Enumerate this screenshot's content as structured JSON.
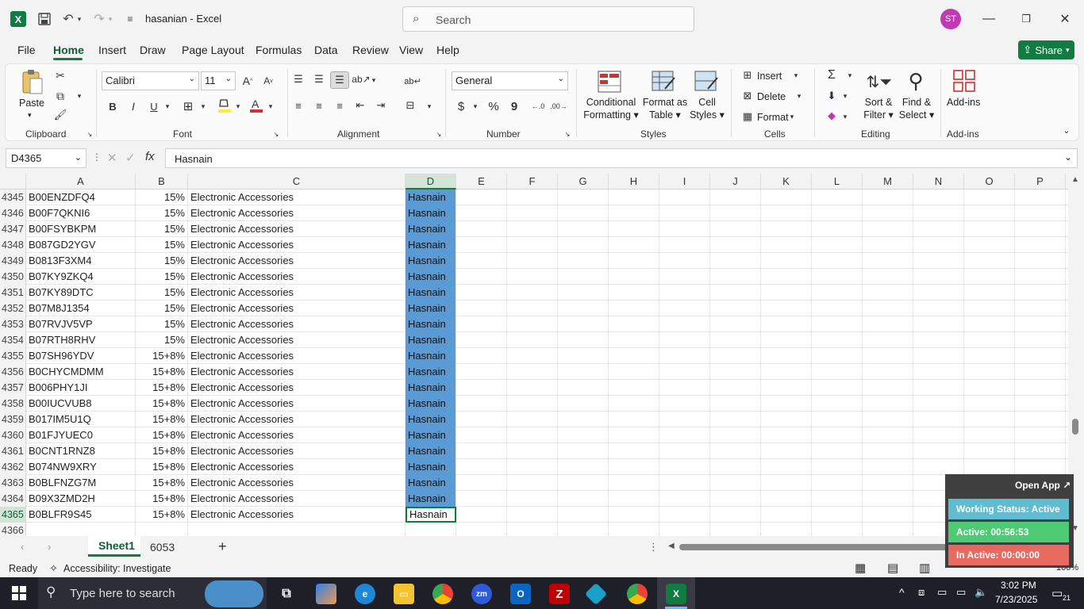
{
  "title_bar": {
    "doc_title": "hasanian  -  Excel",
    "search_placeholder": "Search",
    "user_initials": "ST",
    "accent": "#107c41"
  },
  "menu": {
    "items": [
      "File",
      "Home",
      "Insert",
      "Draw",
      "Page Layout",
      "Formulas",
      "Data",
      "Review",
      "View",
      "Help"
    ],
    "active": "Home",
    "share_label": "Share"
  },
  "ribbon": {
    "clipboard": {
      "paste": "Paste",
      "label": "Clipboard"
    },
    "font": {
      "name": "Calibri",
      "size": "11",
      "bold": "B",
      "italic": "I",
      "underline": "U",
      "label": "Font"
    },
    "alignment": {
      "label": "Alignment"
    },
    "number": {
      "format": "General",
      "currency": "$",
      "percent": "%",
      "comma": "9",
      "label": "Number"
    },
    "styles": {
      "conditional": "Conditional",
      "conditional2": "Formatting",
      "format_table": "Format as",
      "format_table2": "Table",
      "cell_styles": "Cell",
      "cell_styles2": "Styles",
      "label": "Styles"
    },
    "cells": {
      "insert": "Insert",
      "delete": "Delete",
      "format": "Format",
      "label": "Cells"
    },
    "editing": {
      "sort": "Sort &",
      "sort2": "Filter",
      "find": "Find &",
      "find2": "Select",
      "label": "Editing"
    },
    "addins": {
      "addins": "Add-ins",
      "label": "Add-ins"
    }
  },
  "formula_bar": {
    "name_box": "D4365",
    "fx": "fx",
    "value": "Hasnain"
  },
  "columns": [
    "A",
    "B",
    "C",
    "D",
    "E",
    "F",
    "G",
    "H",
    "I",
    "J",
    "K",
    "L",
    "M",
    "N",
    "O",
    "P"
  ],
  "selected_column": "D",
  "rows": [
    {
      "n": "4345",
      "a": "B00ENZDFQ4",
      "b": "15%",
      "c": "Electronic Accessories",
      "d": "Hasnain"
    },
    {
      "n": "4346",
      "a": "B00F7QKNI6",
      "b": "15%",
      "c": "Electronic Accessories",
      "d": "Hasnain"
    },
    {
      "n": "4347",
      "a": "B00FSYBKPM",
      "b": "15%",
      "c": "Electronic Accessories",
      "d": "Hasnain"
    },
    {
      "n": "4348",
      "a": "B087GD2YGV",
      "b": "15%",
      "c": "Electronic Accessories",
      "d": "Hasnain"
    },
    {
      "n": "4349",
      "a": "B0813F3XM4",
      "b": "15%",
      "c": "Electronic Accessories",
      "d": "Hasnain"
    },
    {
      "n": "4350",
      "a": "B07KY9ZKQ4",
      "b": "15%",
      "c": "Electronic Accessories",
      "d": "Hasnain"
    },
    {
      "n": "4351",
      "a": "B07KY89DTC",
      "b": "15%",
      "c": "Electronic Accessories",
      "d": "Hasnain"
    },
    {
      "n": "4352",
      "a": "B07M8J1354",
      "b": "15%",
      "c": "Electronic Accessories",
      "d": "Hasnain"
    },
    {
      "n": "4353",
      "a": "B07RVJV5VP",
      "b": "15%",
      "c": "Electronic Accessories",
      "d": "Hasnain"
    },
    {
      "n": "4354",
      "a": "B07RTH8RHV",
      "b": "15%",
      "c": "Electronic Accessories",
      "d": "Hasnain"
    },
    {
      "n": "4355",
      "a": "B07SH96YDV",
      "b": "15+8%",
      "c": "Electronic Accessories",
      "d": "Hasnain"
    },
    {
      "n": "4356",
      "a": "B0CHYCMDMM",
      "b": "15+8%",
      "c": "Electronic Accessories",
      "d": "Hasnain"
    },
    {
      "n": "4357",
      "a": "B006PHY1JI",
      "b": "15+8%",
      "c": "Electronic Accessories",
      "d": "Hasnain"
    },
    {
      "n": "4358",
      "a": "B00IUCVUB8",
      "b": "15+8%",
      "c": "Electronic Accessories",
      "d": "Hasnain"
    },
    {
      "n": "4359",
      "a": "B017IM5U1Q",
      "b": "15+8%",
      "c": "Electronic Accessories",
      "d": "Hasnain"
    },
    {
      "n": "4360",
      "a": "B01FJYUEC0",
      "b": "15+8%",
      "c": "Electronic Accessories",
      "d": "Hasnain"
    },
    {
      "n": "4361",
      "a": "B0CNT1RNZ8",
      "b": "15+8%",
      "c": "Electronic Accessories",
      "d": "Hasnain"
    },
    {
      "n": "4362",
      "a": "B074NW9XRY",
      "b": "15+8%",
      "c": "Electronic Accessories",
      "d": "Hasnain"
    },
    {
      "n": "4363",
      "a": "B0BLFNZG7M",
      "b": "15+8%",
      "c": "Electronic Accessories",
      "d": "Hasnain"
    },
    {
      "n": "4364",
      "a": "B09X3ZMD2H",
      "b": "15+8%",
      "c": "Electronic Accessories",
      "d": "Hasnain"
    },
    {
      "n": "4365",
      "a": "B0BLFR9S45",
      "b": "15+8%",
      "c": "Electronic Accessories",
      "d": "Hasnain"
    },
    {
      "n": "4366",
      "a": "",
      "b": "",
      "c": "",
      "d": ""
    }
  ],
  "sheet_tabs": {
    "tab1": "Sheet1",
    "tab2": "6053",
    "add": "+"
  },
  "status": {
    "ready": "Ready",
    "accessibility": "Accessibility: Investigate",
    "zoom": "100%"
  },
  "widget": {
    "open_app": "Open App",
    "working": "Working Status: Active",
    "active": "Active: 00:56:53",
    "inactive": "In Active: 00:00:00"
  },
  "taskbar": {
    "search_placeholder": "Type here to search",
    "time": "3:02 PM",
    "date": "7/23/2025",
    "notifications": "21"
  }
}
